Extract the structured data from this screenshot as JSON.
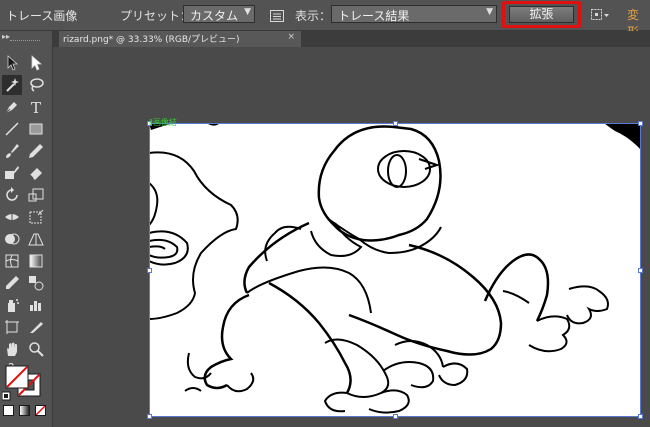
{
  "control_bar": {
    "title": "トレース画像",
    "preset_label": "プリセット：",
    "preset_value": "カスタム",
    "display_label": "表示：",
    "display_value": "トレース結果",
    "expand_button": "拡張",
    "transform_link": "変形",
    "icons": [
      "tracing-panel-icon",
      "align-options-icon",
      "dropdown-arrow-icon"
    ]
  },
  "document_tab": {
    "title": "rizard.png* @ 33.33% (RGB/プレビュー)",
    "close_symbol": "×"
  },
  "canvas": {
    "object_tag": "Ⅱ画像結"
  },
  "tools": [
    "selection-tool-icon",
    "direct-selection-tool-icon",
    "magic-wand-tool-icon",
    "lasso-tool-icon",
    "pen-tool-icon",
    "type-tool-icon",
    "line-tool-icon",
    "rectangle-tool-icon",
    "paintbrush-tool-icon",
    "pencil-tool-icon",
    "blob-brush-tool-icon",
    "eraser-tool-icon",
    "rotate-tool-icon",
    "scale-tool-icon",
    "width-tool-icon",
    "free-transform-tool-icon",
    "shape-builder-tool-icon",
    "perspective-grid-tool-icon",
    "mesh-tool-icon",
    "gradient-tool-icon",
    "eyedropper-tool-icon",
    "blend-tool-icon",
    "symbol-sprayer-tool-icon",
    "column-graph-tool-icon",
    "artboard-tool-icon",
    "slice-tool-icon",
    "hand-tool-icon",
    "zoom-tool-icon",
    "help-icon",
    "fill-stroke-swatch-icon",
    "normal-mode-icon",
    "gradient-mode-icon",
    "none-mode-icon"
  ],
  "colors": {
    "highlight": "#e01010",
    "selection": "#5a78d6",
    "link": "#e8a23c",
    "tag": "#33cc33"
  }
}
